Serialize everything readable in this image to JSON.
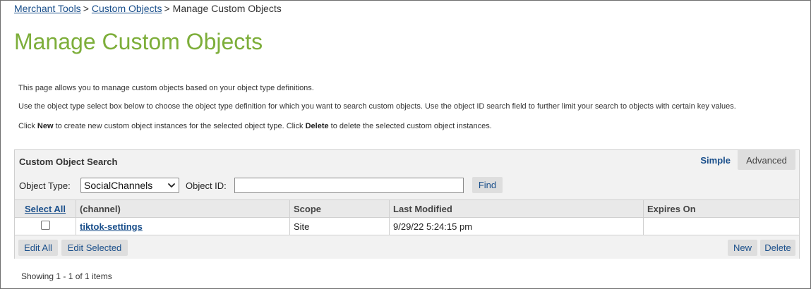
{
  "breadcrumb": {
    "items": [
      "Merchant Tools",
      "Custom Objects"
    ],
    "separator": ">",
    "current": "Manage Custom Objects"
  },
  "page_title": "Manage Custom Objects",
  "description": {
    "line1": "This page allows you to manage custom objects based on your object type definitions.",
    "line2": "Use the object type select box below to choose the object type definition for which you want to search custom objects. Use the object ID search field to further limit your search to objects with certain key values.",
    "line3_a": "Click ",
    "line3_new": "New",
    "line3_b": " to create new custom object instances for the selected object type. Click ",
    "line3_delete": "Delete",
    "line3_c": " to delete the selected custom object instances."
  },
  "search": {
    "title": "Custom Object Search",
    "mode_simple": "Simple",
    "mode_advanced": "Advanced",
    "object_type_label": "Object Type:",
    "object_type_value": "SocialChannels",
    "object_id_label": "Object ID:",
    "object_id_value": "",
    "find_label": "Find"
  },
  "table": {
    "headers": [
      "Select All",
      "(channel)",
      "Scope",
      "Last Modified",
      "Expires On"
    ],
    "rows": [
      {
        "channel": "tiktok-settings",
        "scope": "Site",
        "last_modified": "9/29/22 5:24:15 pm",
        "expires_on": "",
        "checked": false
      }
    ]
  },
  "actions": {
    "edit_all": "Edit All",
    "edit_selected": "Edit Selected",
    "new": "New",
    "delete": "Delete"
  },
  "paging": "Showing 1 - 1 of 1 items",
  "colors": {
    "title_green": "#7dae3a",
    "link_blue": "#1a4f8b",
    "panel_bg": "#f2f2f2",
    "button_bg": "#dedede"
  }
}
